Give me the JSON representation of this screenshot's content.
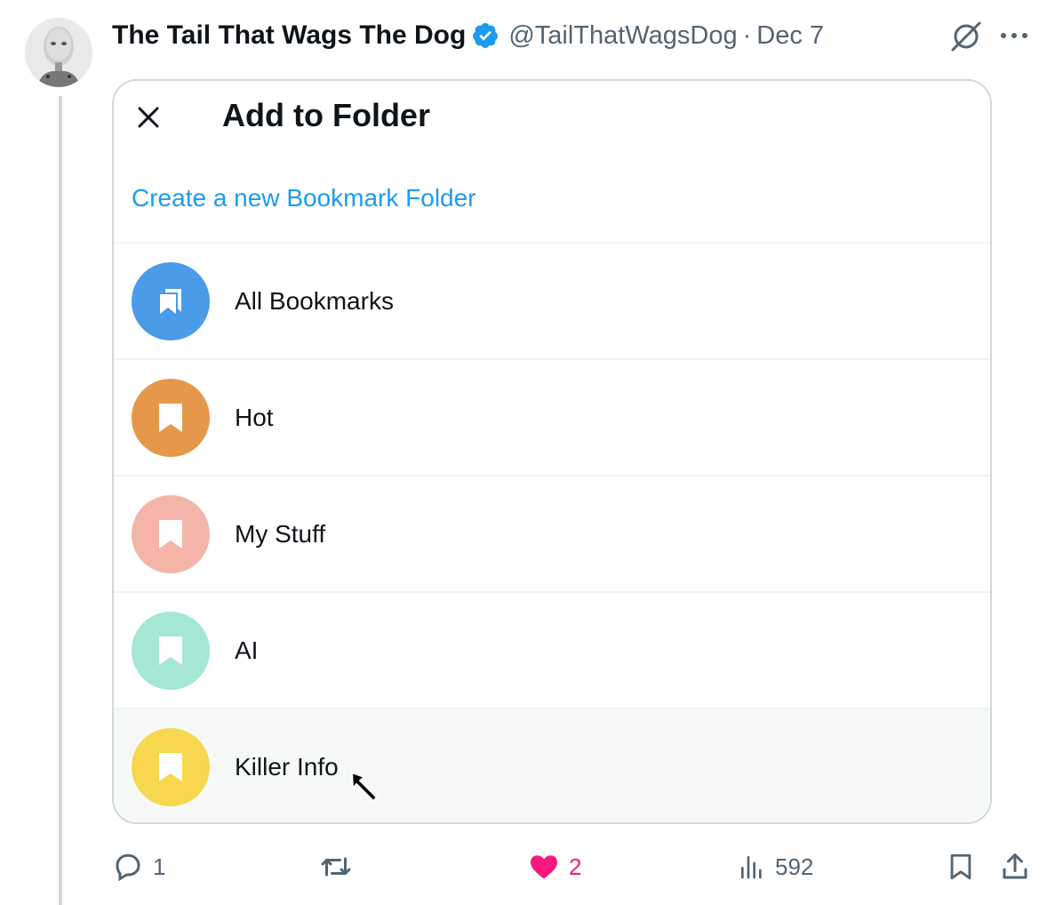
{
  "tweet": {
    "display_name": "The Tail That Wags The Dog",
    "handle": "@TailThatWagsDog",
    "separator": "·",
    "date": "Dec 7"
  },
  "modal": {
    "title": "Add to Folder",
    "create_link": "Create a new Bookmark Folder",
    "folders": [
      {
        "label": "All Bookmarks",
        "color": "#4a9be8",
        "icon": "bookmarks-stack-icon"
      },
      {
        "label": "Hot",
        "color": "#e5984a",
        "icon": "bookmark-icon"
      },
      {
        "label": "My Stuff",
        "color": "#f4b5a8",
        "icon": "bookmark-icon"
      },
      {
        "label": "AI",
        "color": "#a5e7d5",
        "icon": "bookmark-icon"
      },
      {
        "label": "Killer Info",
        "color": "#f6d74e",
        "icon": "bookmark-icon"
      }
    ]
  },
  "actions": {
    "replies": "1",
    "reposts": "",
    "likes": "2",
    "views": "592"
  },
  "colors": {
    "accent": "#1d9bf0",
    "like": "#f91880",
    "text_secondary": "#536471"
  }
}
